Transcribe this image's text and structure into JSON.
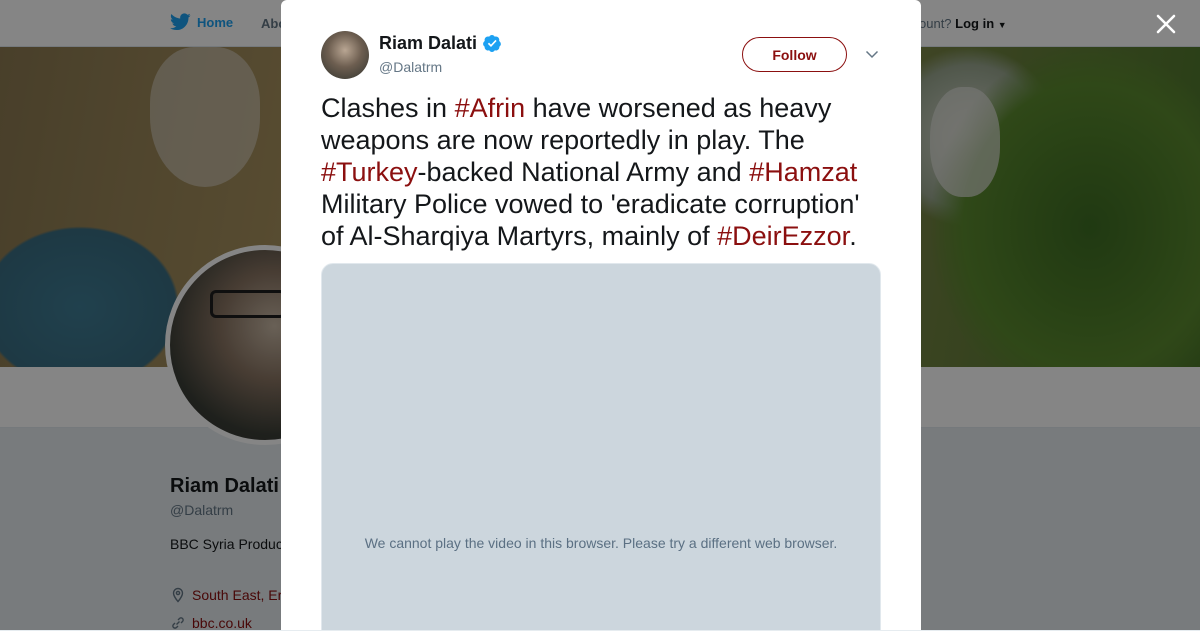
{
  "nav": {
    "home_label": "Home",
    "about_label": "Abo",
    "login_prefix": "ccount?",
    "login_label": "Log in"
  },
  "profile": {
    "name": "Riam Dalati",
    "handle": "@Dalatrm",
    "bio": "BBC Syria Produc are my own -",
    "location": "South East, Er",
    "link": "bbc.co.uk"
  },
  "tweet": {
    "author_name": "Riam Dalati",
    "author_handle": "@Dalatrm",
    "verified": true,
    "follow_label": "Follow",
    "text_segments": [
      {
        "text": "Clashes in ",
        "tag": false
      },
      {
        "text": "#Afrin",
        "tag": true
      },
      {
        "text": " have worsened as heavy weapons are now reportedly in play. The ",
        "tag": false
      },
      {
        "text": "#Turkey",
        "tag": true
      },
      {
        "text": "-backed National Army and ",
        "tag": false
      },
      {
        "text": "#Hamzat",
        "tag": true
      },
      {
        "text": " Military Police vowed to 'eradicate corruption' of Al-Sharqiya Martyrs, mainly of ",
        "tag": false
      },
      {
        "text": "#DeirEzzor",
        "tag": true
      },
      {
        "text": ".",
        "tag": false
      }
    ],
    "video_message": "We cannot play the video in this browser. Please try a different web browser."
  },
  "colors": {
    "accent": "#8b0f0f",
    "twitter_blue": "#1da1f2",
    "verified_blue": "#1da1f2",
    "video_bg": "#ccd6dd"
  },
  "icons": {
    "nav_logo": "twitter-bird-icon",
    "verified": "verified-badge-icon",
    "more": "chevron-down-icon",
    "close": "close-icon",
    "location": "location-pin-icon",
    "link": "link-icon"
  }
}
